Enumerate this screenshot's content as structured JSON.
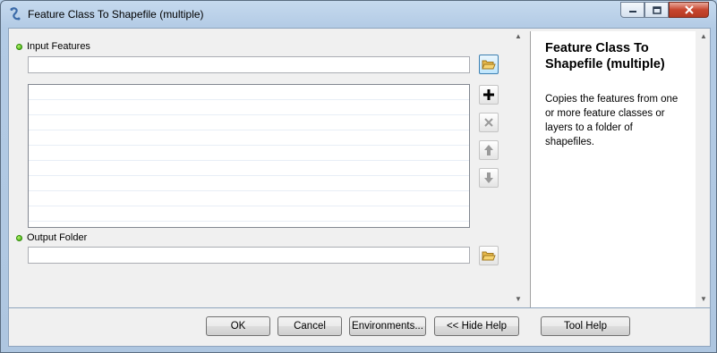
{
  "window": {
    "title": "Feature Class To Shapefile (multiple)"
  },
  "form": {
    "input_features_label": "Input Features",
    "input_features_value": "",
    "output_folder_label": "Output Folder",
    "output_folder_value": ""
  },
  "help": {
    "title": "Feature Class To Shapefile (multiple)",
    "body": "Copies the features from one or more feature classes or layers to a folder of shapefiles."
  },
  "buttons": {
    "ok": "OK",
    "cancel": "Cancel",
    "environments": "Environments...",
    "hide_help": "<< Hide Help",
    "tool_help": "Tool Help"
  },
  "colors": {
    "required_dot": "#35a20a",
    "title_bar": "#b3cbe5",
    "close_button": "#c7452e"
  }
}
